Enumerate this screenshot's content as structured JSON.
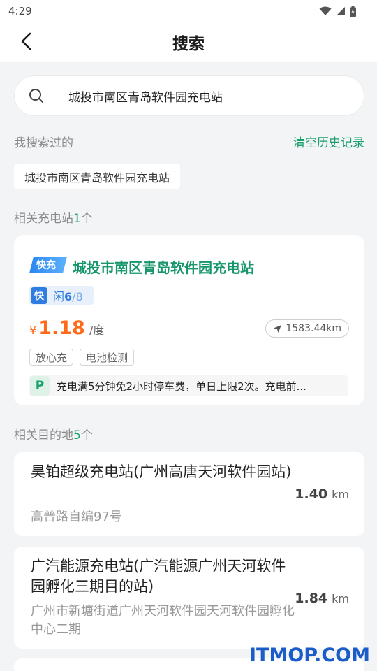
{
  "status_bar": {
    "time": "4:29"
  },
  "nav": {
    "title": "搜索"
  },
  "search": {
    "value": "城投市南区青岛软件园充电站",
    "placeholder": ""
  },
  "history": {
    "label": "我搜索过的",
    "clear_label": "清空历史记录",
    "items": [
      "城投市南区青岛软件园充电站"
    ]
  },
  "stations_section": {
    "label": "相关充电站",
    "count": "1",
    "suffix": "个"
  },
  "station": {
    "badge": "快充",
    "name": "城投市南区青岛软件园充电站",
    "avail_icon": "快",
    "avail_prefix": "闲",
    "avail_free": "6",
    "avail_total": "/8",
    "currency": "¥",
    "price": "1.18",
    "price_unit": "/度",
    "distance": "1583.44km",
    "tags": [
      "放心充",
      "电池检测"
    ],
    "parking_icon": "P",
    "parking_text": "充电满5分钟免2小时停车费，单日上限2次。充电前..."
  },
  "dest_section": {
    "label": "相关目的地",
    "count": "5",
    "suffix": "个"
  },
  "destinations": [
    {
      "name": "昊铂超级充电站(广州高唐天河软件园站)",
      "address": "高普路自编97号",
      "distance": "1.40",
      "unit": "km"
    },
    {
      "name": "广汽能源充电站(广汽能源广州天河软件园孵化三期目的站)",
      "address": "广州市新塘街道广州天河软件园天河软件园孵化中心二期",
      "distance": "1.84",
      "unit": "km"
    }
  ],
  "watermark": "ITMOP.COM",
  "colors": {
    "accent": "#1aa06d",
    "price": "#ff6a1a",
    "availability": "#2f7de1"
  }
}
